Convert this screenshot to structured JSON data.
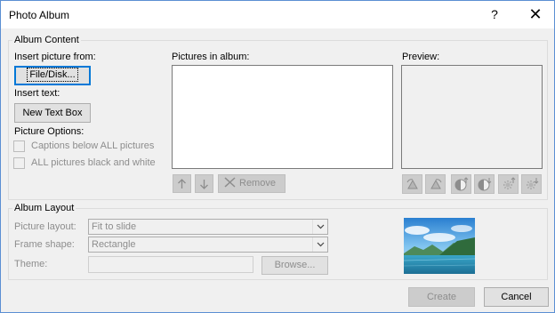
{
  "window": {
    "title": "Photo Album",
    "help_glyph": "?",
    "close_glyph": "✕"
  },
  "album_content": {
    "group_label": "Album Content",
    "insert_picture_label": "Insert picture from:",
    "file_disk_button": "File/Disk...",
    "insert_text_label": "Insert text:",
    "new_text_box_button": "New Text Box",
    "picture_options_label": "Picture Options:",
    "captions_option": "Captions below ALL pictures",
    "black_white_option": "ALL pictures black and white",
    "pictures_in_album_label": "Pictures in album:",
    "preview_label": "Preview:",
    "remove_button": "Remove"
  },
  "album_layout": {
    "group_label": "Album Layout",
    "picture_layout_label": "Picture layout:",
    "picture_layout_value": "Fit to slide",
    "frame_shape_label": "Frame shape:",
    "frame_shape_value": "Rectangle",
    "theme_label": "Theme:",
    "theme_value": "",
    "browse_button": "Browse..."
  },
  "footer": {
    "create_button": "Create",
    "cancel_button": "Cancel"
  },
  "icons": {
    "move_up": "arrow-up-icon",
    "move_down": "arrow-down-icon",
    "remove": "remove-x-icon",
    "rotate_left": "rotate-left-icon",
    "rotate_right": "rotate-right-icon",
    "contrast_up": "contrast-increase-icon",
    "contrast_down": "contrast-decrease-icon",
    "brightness_up": "brightness-increase-icon",
    "brightness_down": "brightness-decrease-icon"
  },
  "colors": {
    "accent": "#0078d7",
    "disabled_text": "#8d8d8d",
    "dialog_bg": "#f0f0f0"
  }
}
